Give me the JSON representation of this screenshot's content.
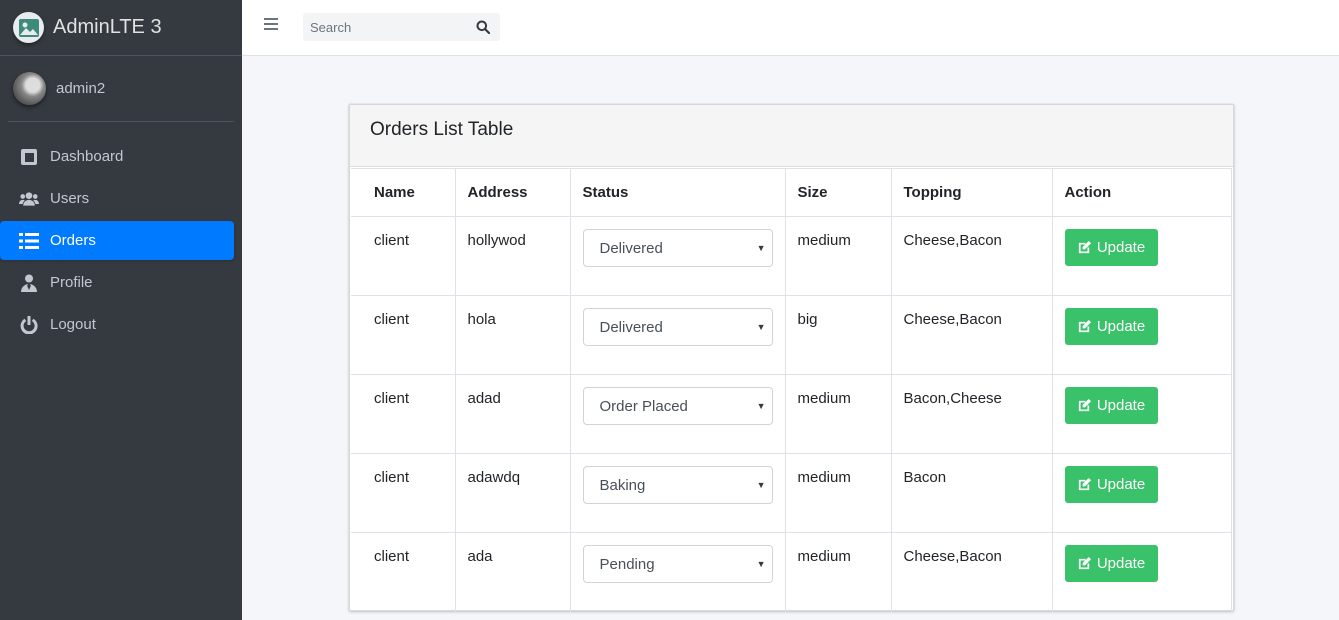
{
  "brand": {
    "title": "AdminLTE 3"
  },
  "user": {
    "name": "admin2"
  },
  "sidebar": {
    "items": [
      {
        "label": "Dashboard",
        "icon": "tablet-icon",
        "active": false
      },
      {
        "label": "Users",
        "icon": "users-icon",
        "active": false
      },
      {
        "label": "Orders",
        "icon": "list-icon",
        "active": true
      },
      {
        "label": "Profile",
        "icon": "user-tie-icon",
        "active": false
      },
      {
        "label": "Logout",
        "icon": "power-icon",
        "active": false
      }
    ]
  },
  "search": {
    "placeholder": "Search"
  },
  "card": {
    "title": "Orders List Table"
  },
  "table": {
    "headers": [
      "Name",
      "Address",
      "Status",
      "Size",
      "Topping",
      "Action"
    ],
    "rows": [
      {
        "name": "client",
        "address": "hollywod",
        "status": "Delivered",
        "size": "medium",
        "topping": "Cheese,Bacon",
        "action": "Update"
      },
      {
        "name": "client",
        "address": "hola",
        "status": "Delivered",
        "size": "big",
        "topping": "Cheese,Bacon",
        "action": "Update"
      },
      {
        "name": "client",
        "address": "adad",
        "status": "Order Placed",
        "size": "medium",
        "topping": "Bacon,Cheese",
        "action": "Update"
      },
      {
        "name": "client",
        "address": "adawdq",
        "status": "Baking",
        "size": "medium",
        "topping": "Bacon",
        "action": "Update"
      },
      {
        "name": "client",
        "address": "ada",
        "status": "Pending",
        "size": "medium",
        "topping": "Cheese,Bacon",
        "action": "Update"
      }
    ]
  },
  "colors": {
    "sidebar": "#343a40",
    "active": "#007bff",
    "update_button": "#3ac26a"
  }
}
